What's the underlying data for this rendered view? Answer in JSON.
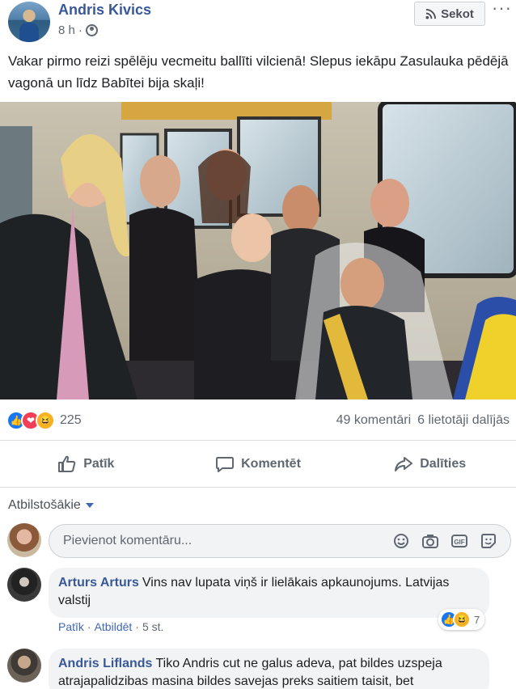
{
  "post": {
    "author": "Andris Kivics",
    "time": "8 h",
    "follow_label": "Sekot",
    "text": "Vakar pirmo reizi spēlēju vecmeitu ballīti vilcienā! Slepus iekāpu Zasulauka pēdējā vagonā un līdz Babītei bija skaļi!"
  },
  "stats": {
    "reaction_count": "225",
    "comments": "49 komentāri",
    "shares": "6 lietotāji dalījās"
  },
  "actions": {
    "like": "Patīk",
    "comment": "Komentēt",
    "share": "Dalīties"
  },
  "comments_section": {
    "filter_label": "Atbilstošākie",
    "input_placeholder": "Pievienot komentāru...",
    "comments": [
      {
        "name": "Arturs Arturs",
        "text": "Vins nav lupata viņš ir lielākais apkaunojums. Latvijas valstij",
        "like_label": "Patīk",
        "reply_label": "Atbildēt",
        "time": "5 st.",
        "reaction_count": "7"
      },
      {
        "name": "Andris Liflands",
        "text": "Tiko Andris cut ne galus adeva, pat bildes uzspeja atrajapalidzibas masina bildes savejas preks saitiem taisit, bet"
      }
    ]
  },
  "icons": [
    "rss-icon",
    "more-icon",
    "globe-icon",
    "like-icon",
    "comment-icon",
    "share-icon",
    "emoji-icon",
    "camera-icon",
    "gif-icon",
    "sticker-icon"
  ]
}
